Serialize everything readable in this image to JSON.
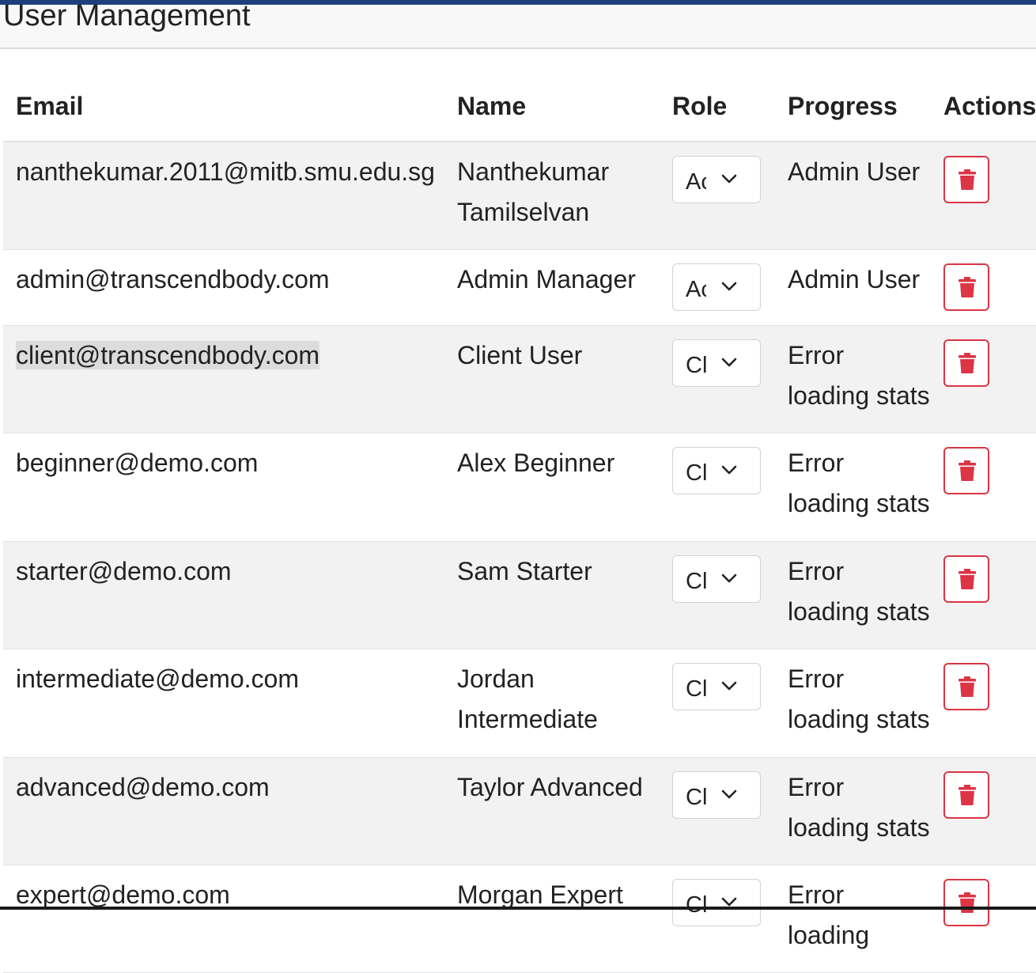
{
  "page": {
    "title": "User Management",
    "accent_color": "#1f3f7a",
    "danger_color": "#dc3545"
  },
  "table": {
    "headers": {
      "email": "Email",
      "name": "Name",
      "role": "Role",
      "progress": "Progress",
      "actions": "Actions"
    },
    "rows": [
      {
        "email": "nanthekumar.2011@mitb.smu.edu.sg",
        "name": "Nanthekumar Tamilselvan",
        "role": "Ac",
        "progress": "Admin User"
      },
      {
        "email": "admin@transcendbody.com",
        "name": "Admin Manager",
        "role": "Ac",
        "progress": "Admin User"
      },
      {
        "email": "client@transcendbody.com",
        "name": "Client User",
        "role": "Cl",
        "progress": "Error loading stats"
      },
      {
        "email": "beginner@demo.com",
        "name": "Alex Beginner",
        "role": "Cl",
        "progress": "Error loading stats"
      },
      {
        "email": "starter@demo.com",
        "name": "Sam Starter",
        "role": "Cl",
        "progress": "Error loading stats"
      },
      {
        "email": "intermediate@demo.com",
        "name": "Jordan Intermediate",
        "role": "Cl",
        "progress": "Error loading stats"
      },
      {
        "email": "advanced@demo.com",
        "name": "Taylor Advanced",
        "role": "Cl",
        "progress": "Error loading stats"
      },
      {
        "email": "expert@demo.com",
        "name": "Morgan Expert",
        "role": "Cl",
        "progress": "Error loading"
      }
    ],
    "delete_icon": "trash-icon",
    "dropdown_icon": "chevron-down-icon"
  }
}
